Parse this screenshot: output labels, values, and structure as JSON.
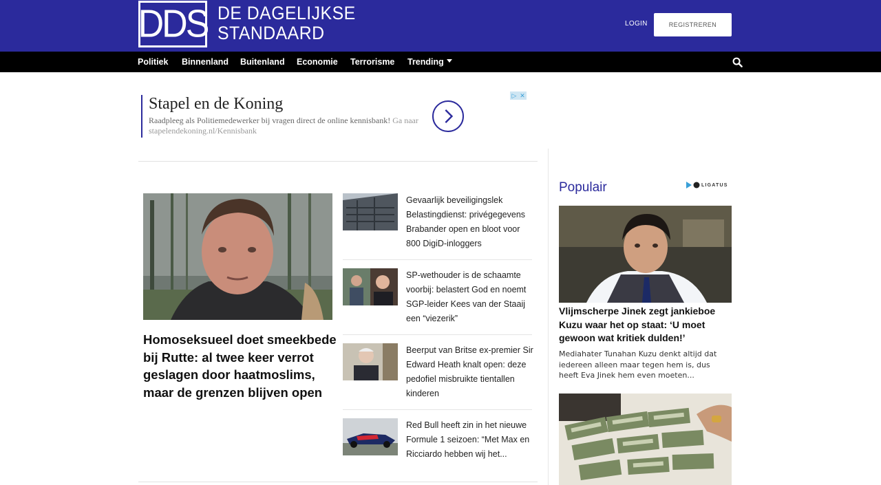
{
  "header": {
    "logo_mark": "DDS",
    "logo_line1": "DE DAGELIJKSE",
    "logo_line2": "STANDAARD",
    "login_label": "LOGIN",
    "register_label": "REGISTREREN",
    "brand_color": "#2b2a9c"
  },
  "nav": {
    "items": [
      "Politiek",
      "Binnenland",
      "Buitenland",
      "Economie",
      "Terrorisme",
      "Trending"
    ],
    "search_icon": "search-icon"
  },
  "ad": {
    "title": "Stapel en de Koning",
    "description": "Raadpleeg als Politiemedewerker bij vragen direct de online kennisbank!",
    "url_text": "Ga naar stapelendekoning.nl/Kennisbank"
  },
  "feature": {
    "title": "Homoseksueel doet smeekbede bij Rutte: al twee keer verrot geslagen door haatmoslims, maar de grenzen blijven open"
  },
  "list": [
    {
      "text": "Gevaarlijk beveiligingslek Belastingdienst: privégegevens Brabander open en bloot voor 800 DigiD-inloggers"
    },
    {
      "text": "SP-wethouder is de schaamte voorbij: belastert God en noemt SGP-leider Kees van der Staaij een “viezerik”"
    },
    {
      "text": "Beerput van Britse ex-premier Sir Edward Heath knalt open: deze pedofiel misbruikte tientallen kinderen"
    },
    {
      "text": "Red Bull heeft zin in het nieuwe Formule 1 seizoen: “Met Max en Ricciardo hebben wij het..."
    }
  ],
  "popular": {
    "heading": "Populair",
    "sponsor": "LIGATUS",
    "items": [
      {
        "title": "Vlijmscherpe Jinek zegt jankieboe Kuzu waar het op staat: ‘U moet gewoon wat kritiek dulden!’",
        "desc": "Mediahater Tunahan Kuzu denkt altijd dat iedereen alleen maar tegen hem is, dus heeft Eva Jinek hem even moeten..."
      }
    ]
  }
}
